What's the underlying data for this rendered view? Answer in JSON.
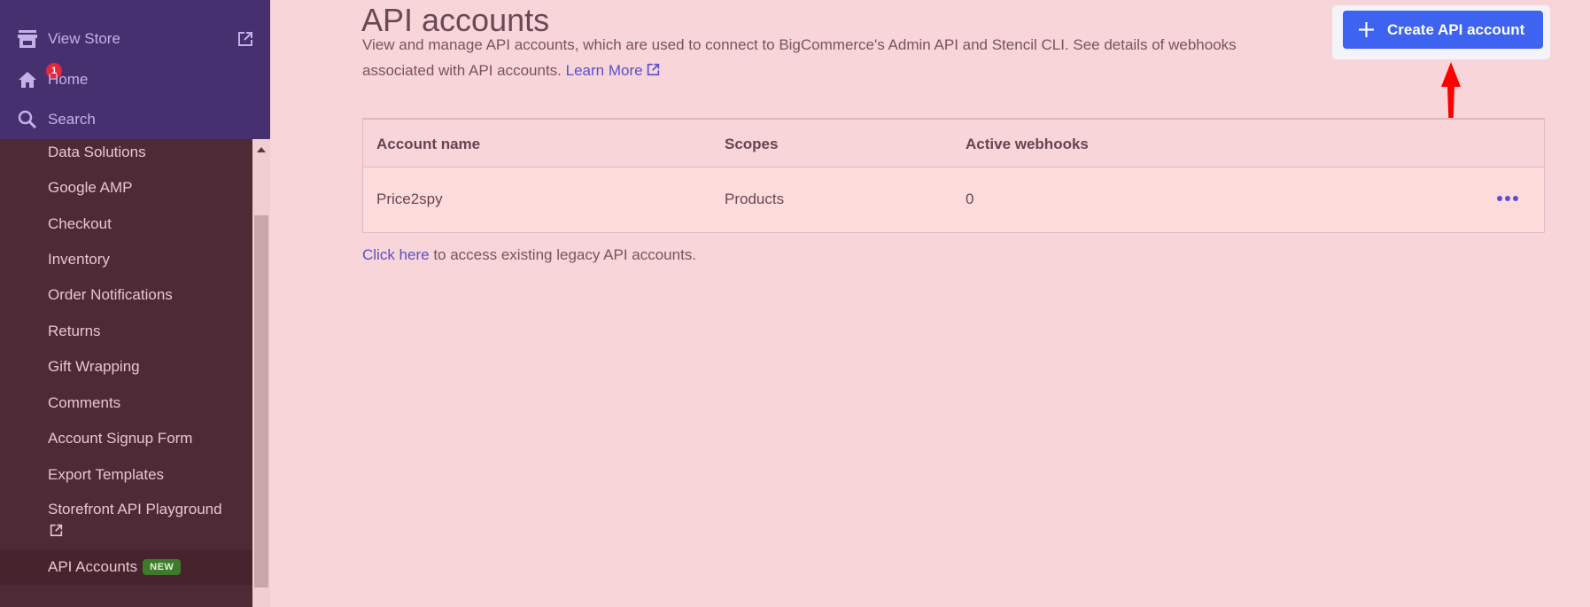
{
  "sidebar": {
    "top": [
      {
        "label": "View Store",
        "icon": "storefront-icon",
        "external": true
      },
      {
        "label": "Home",
        "icon": "home-icon",
        "badge": "1"
      },
      {
        "label": "Search",
        "icon": "search-icon"
      }
    ],
    "items": [
      {
        "label": "Data Solutions"
      },
      {
        "label": "Google AMP"
      },
      {
        "label": "Checkout"
      },
      {
        "label": "Inventory"
      },
      {
        "label": "Order Notifications"
      },
      {
        "label": "Returns"
      },
      {
        "label": "Gift Wrapping"
      },
      {
        "label": "Comments"
      },
      {
        "label": "Account Signup Form"
      },
      {
        "label": "Export Templates"
      },
      {
        "label": "Storefront API Playground",
        "external": true
      },
      {
        "label": "API Accounts",
        "badge": "NEW",
        "active": true
      }
    ]
  },
  "main": {
    "title": "API accounts",
    "description": "View and manage API accounts, which are used to connect to BigCommerce's Admin API and Stencil CLI. See details of webhooks associated with API accounts.",
    "learn_more": "Learn More",
    "create_button": "Create API account",
    "table": {
      "columns": [
        "Account name",
        "Scopes",
        "Active webhooks"
      ],
      "rows": [
        {
          "name": "Price2spy",
          "scopes": "Products",
          "webhooks": "0"
        }
      ]
    },
    "legacy_link": "Click here",
    "legacy_text": " to access existing legacy API accounts."
  },
  "colors": {
    "sidebar_top": "#46306f",
    "sidebar": "#4e2936",
    "accent": "#3d63f0",
    "link": "#5a4fcf",
    "badge_new": "#3e7a2c",
    "badge_count": "#e3283e",
    "annotation_arrow": "#ff0000"
  }
}
